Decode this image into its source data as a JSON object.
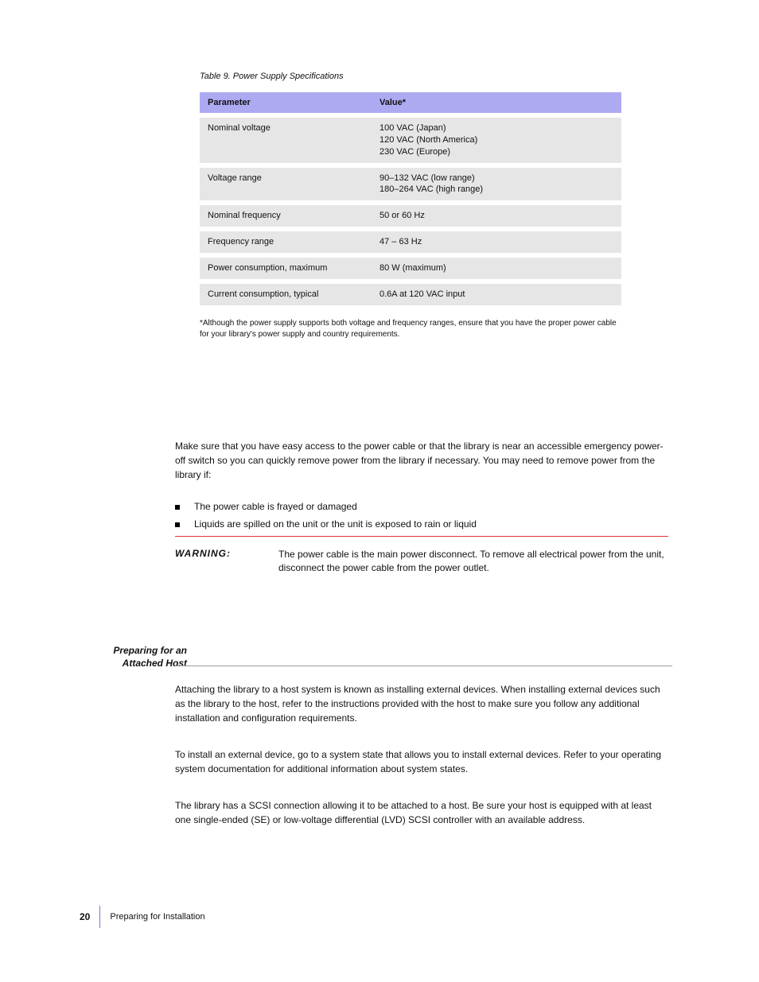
{
  "table": {
    "caption": "Table 9. Power Supply Specifications",
    "header_left": "Parameter",
    "header_right": "Value*",
    "rows": [
      {
        "param": "Nominal voltage",
        "value": "100 VAC (Japan)\n120 VAC (North America)\n230 VAC (Europe)"
      },
      {
        "param": "Voltage range",
        "value": "90–132 VAC (low range)\n180–264 VAC (high range)"
      },
      {
        "param": "Nominal frequency",
        "value": "50 or 60 Hz"
      },
      {
        "param": "Frequency range",
        "value": "47 – 63 Hz"
      },
      {
        "param": "Power consumption, maximum",
        "value": "80 W (maximum)"
      },
      {
        "param": "Current consumption, typical",
        "value": "0.6A at 120 VAC input"
      }
    ],
    "footnote": "*Although the power supply supports both voltage and frequency ranges, ensure that you have the proper power cable for your library's power supply and country requirements."
  },
  "intro": "Make sure that you have easy access to the power cable or that the library is near an accessible emergency power-off switch so you can quickly remove power from the library if necessary. You may need to remove power from the library if:",
  "bullets": [
    "The power cable is frayed or damaged",
    "Liquids are spilled on the unit or the unit is exposed to rain or liquid"
  ],
  "warning": {
    "label": "WARNING:",
    "text": "The power cable is the main power disconnect. To remove all electrical power from the unit, disconnect the power cable from the power outlet."
  },
  "section": {
    "heading": "Preparing for an Attached Host",
    "p1": "Attaching the library to a host system is known as installing external devices. When installing external devices such as the library to the host, refer to the instructions provided with the host to make sure you follow any additional installation and configuration requirements.",
    "p2": "To install an external device, go to a system state that allows you to install external devices. Refer to your operating system documentation for additional information about system states.",
    "p3": "The library has a SCSI connection allowing it to be attached to a host. Be sure your host is equipped with at least one single-ended (SE) or low-voltage differential (LVD) SCSI controller with an available address."
  },
  "footer": {
    "page": "20",
    "text": "Preparing for Installation"
  }
}
